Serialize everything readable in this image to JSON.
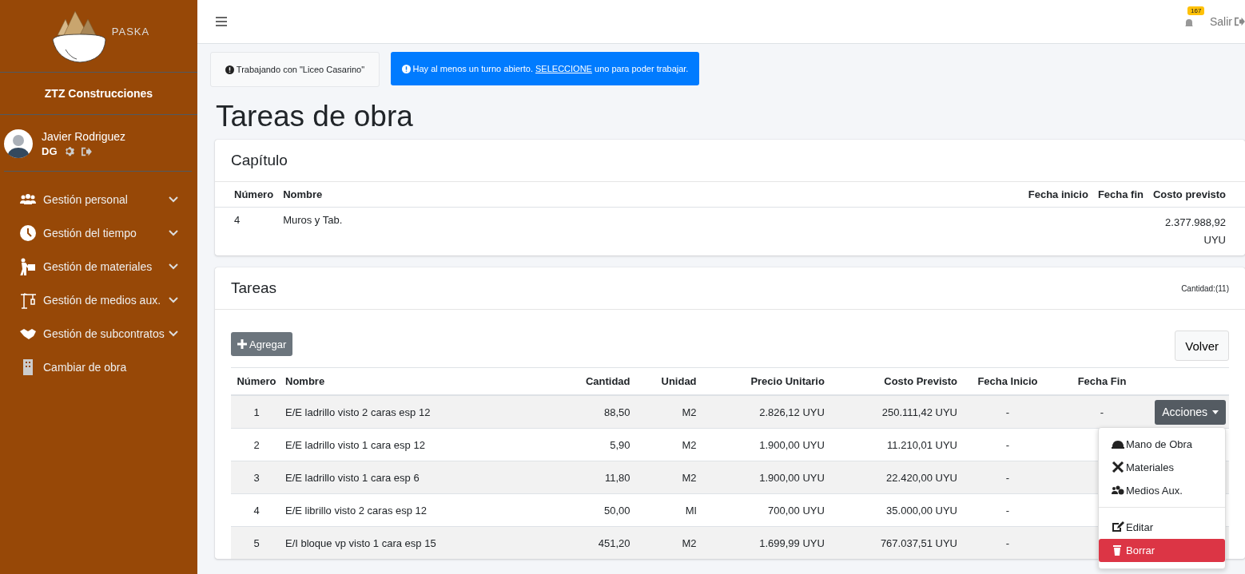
{
  "sidebar": {
    "brand": "PASKA",
    "company": "ZTZ Construcciones",
    "user": {
      "name": "Javier Rodriguez",
      "role": "DG"
    },
    "items": [
      {
        "label": "Gestión personal",
        "expandable": true
      },
      {
        "label": "Gestión del tiempo",
        "expandable": true
      },
      {
        "label": "Gestión de materiales",
        "expandable": true
      },
      {
        "label": "Gestión de medios aux.",
        "expandable": true
      },
      {
        "label": "Gestión de subcontratos",
        "expandable": true
      },
      {
        "label": "Cambiar de obra",
        "expandable": false
      }
    ]
  },
  "topbar": {
    "notification_count": "167",
    "logout": "Salir"
  },
  "alerts": [
    {
      "kind": "light",
      "text": "Trabajando con \"Liceo Casarino\""
    },
    {
      "kind": "info",
      "before": "Hay al menos un turno abierto.",
      "link": "SELECCIONE",
      "after": "uno para poder trabajar."
    }
  ],
  "page_title": "Tareas de obra",
  "chapter": {
    "title": "Capítulo",
    "columns": [
      "Número",
      "Nombre",
      "Fecha inicio",
      "Fecha fin",
      "Costo previsto"
    ],
    "rows": [
      [
        "4",
        "Muros y Tab.",
        null,
        null,
        "2.377.988,92 UYU"
      ]
    ]
  },
  "tasks": {
    "title": "Tareas",
    "count": "Cantidad:(11)",
    "add_button": "Agregar",
    "back_button": "Volver",
    "columns": [
      "Número",
      "Nombre",
      "Cantidad",
      "Unidad",
      "Precio Unitario",
      "Costo Previsto",
      "Fecha Inicio",
      "Fecha Fin"
    ],
    "rows": [
      [
        "1",
        "E/E ladrillo visto 2 caras esp 12",
        "88,50",
        "M2",
        "2.826,12 UYU",
        "250.111,42 UYU",
        "-",
        "-"
      ],
      [
        "2",
        "E/E ladrillo visto 1 cara esp 12",
        "5,90",
        "M2",
        "1.900,00 UYU",
        "11.210,01 UYU",
        "-",
        null
      ],
      [
        "3",
        "E/E ladrillo visto 1 cara esp 6",
        "11,80",
        "M2",
        "1.900,00 UYU",
        "22.420,00 UYU",
        "-",
        null
      ],
      [
        "4",
        "E/E librillo visto 2 caras esp 12",
        "50,00",
        "Ml",
        "700,00 UYU",
        "35.000,00 UYU",
        "-",
        null
      ],
      [
        "5",
        "E/I bloque vp visto 1 cara esp 15",
        "451,20",
        "M2",
        "1.699,99 UYU",
        "767.037,51 UYU",
        "-",
        null
      ]
    ],
    "actions_button": "Acciones",
    "menu": [
      {
        "kind": "item",
        "label": "Mano de Obra",
        "selected": false
      },
      {
        "kind": "item",
        "label": "Materiales",
        "selected": false
      },
      {
        "kind": "item",
        "label": "Medios Aux.",
        "selected": false
      },
      {
        "kind": "divider"
      },
      {
        "kind": "item",
        "label": "Editar",
        "selected": false
      },
      {
        "kind": "item",
        "label": "Borrar",
        "selected": true
      }
    ]
  }
}
